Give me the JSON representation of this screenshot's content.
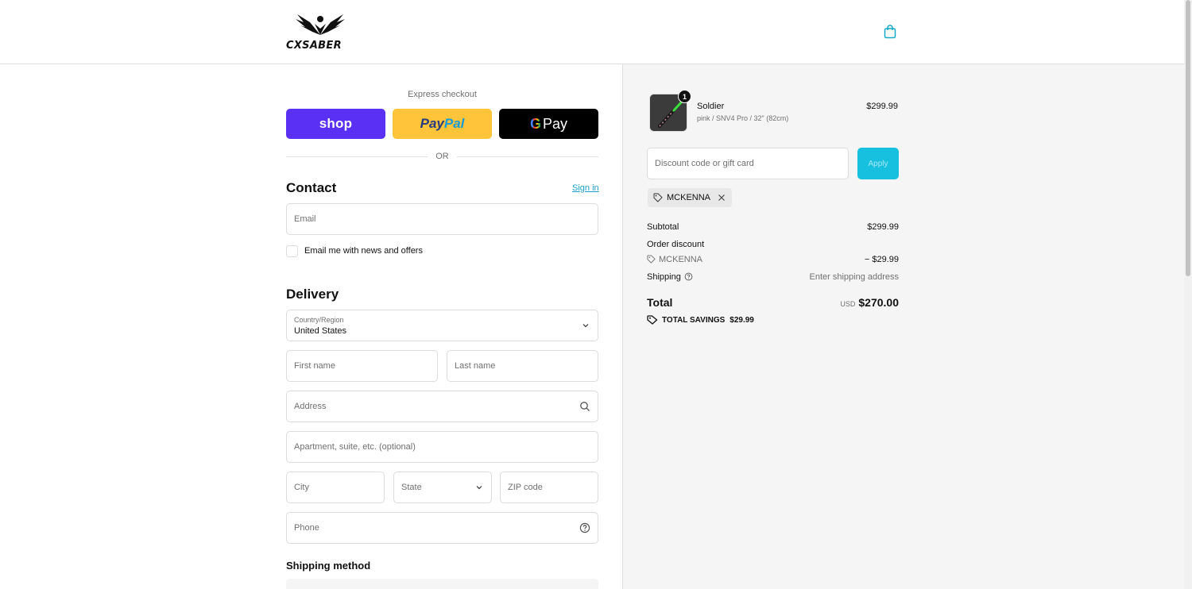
{
  "brand": {
    "name": "CXSABER"
  },
  "express": {
    "label": "Express checkout",
    "shop_label": "shop",
    "paypal_part1": "Pay",
    "paypal_part2": "Pal",
    "gpay_g": "G",
    "gpay_label": "Pay",
    "or_label": "OR"
  },
  "contact": {
    "title": "Contact",
    "sign_in": "Sign in",
    "email_placeholder": "Email",
    "news_label": "Email me with news and offers"
  },
  "delivery": {
    "title": "Delivery",
    "country_label": "Country/Region",
    "country_value": "United States",
    "first_name": "First name",
    "last_name": "Last name",
    "address": "Address",
    "apartment": "Apartment, suite, etc. (optional)",
    "city": "City",
    "state": "State",
    "zip": "ZIP code",
    "phone": "Phone"
  },
  "shipping_method": {
    "title": "Shipping method"
  },
  "order": {
    "item": {
      "name": "Soldier",
      "variant": "pink / SNV4 Pro / 32\" (82cm)",
      "price": "$299.99",
      "quantity": "1"
    },
    "discount_placeholder": "Discount code or gift card",
    "apply_label": "Apply",
    "applied_code": "MCKENNA",
    "subtotal_label": "Subtotal",
    "subtotal_value": "$299.99",
    "order_discount_label": "Order discount",
    "discount_code": "MCKENNA",
    "discount_value": "− $29.99",
    "shipping_label": "Shipping",
    "shipping_value": "Enter shipping address",
    "total_label": "Total",
    "currency": "USD",
    "total_value": "$270.00",
    "savings_label": "TOTAL SAVINGS",
    "savings_value": "$29.99"
  },
  "colors": {
    "accent": "#17c0df",
    "link": "#1d9ec9",
    "shop_pay": "#5a31f4",
    "paypal": "#ffc439",
    "gpay": "#000000",
    "summary_bg": "#f5f5f5"
  },
  "icons": [
    "shopping-bag-icon",
    "search-icon",
    "help-circle-icon",
    "chevron-down-icon",
    "tag-icon",
    "close-icon"
  ]
}
